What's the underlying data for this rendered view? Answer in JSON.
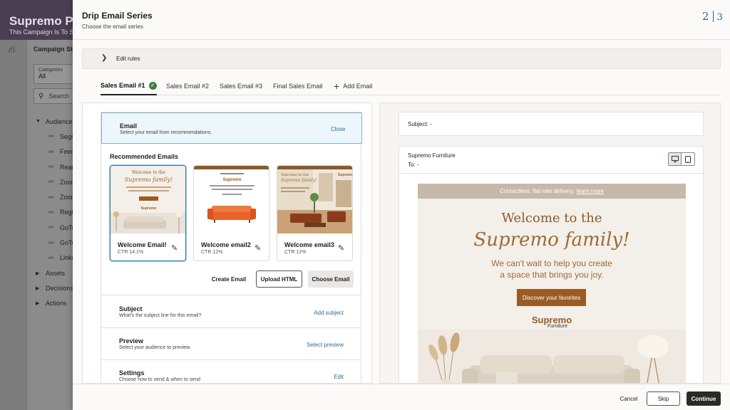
{
  "background": {
    "app_title": "Supremo Pro",
    "app_subtitle": "This Campaign Is To Send",
    "steps_label": "Campaign Ste",
    "categories_label": "Categories",
    "categories_value": "All",
    "search_placeholder": "Search",
    "tree": [
      {
        "label": "Audience",
        "kind": "group-open"
      },
      {
        "label": "Segm",
        "kind": "child"
      },
      {
        "label": "Feed",
        "kind": "child"
      },
      {
        "label": "Read",
        "kind": "child"
      },
      {
        "label": "Zoon",
        "kind": "child"
      },
      {
        "label": "Zoon",
        "kind": "child"
      },
      {
        "label": "Regis",
        "kind": "child"
      },
      {
        "label": "GoTo",
        "kind": "child"
      },
      {
        "label": "GoTo",
        "kind": "child"
      },
      {
        "label": "Linke",
        "kind": "child"
      },
      {
        "label": "Assets",
        "kind": "group"
      },
      {
        "label": "Decisions",
        "kind": "group"
      },
      {
        "label": "Actions",
        "kind": "group"
      }
    ]
  },
  "drawer": {
    "title": "Drip Email Series",
    "subtitle": "Choose the email series",
    "step_current": "2",
    "step_total": "3",
    "edit_rules": "Edit rules"
  },
  "tabs": [
    {
      "label": "Sales Email #1",
      "active": true
    },
    {
      "label": "Sales Email #2",
      "active": false
    },
    {
      "label": "Sales Email #3",
      "active": false
    },
    {
      "label": "Final Sales Email",
      "active": false
    }
  ],
  "add_email_label": "Add Email",
  "email_section": {
    "title": "Email",
    "subtitle": "Select your email from recommendations.",
    "close_label": "Close",
    "recommended_title": "Recommended Emails",
    "recommendations": [
      {
        "name": "Welcome Email!",
        "ctr": "CTR 14.1%"
      },
      {
        "name": "Welcome email2",
        "ctr": "CTR 12%"
      },
      {
        "name": "Welcome email3",
        "ctr": "CTR 12%"
      }
    ],
    "create_label": "Create Email",
    "upload_label": "Upload HTML",
    "choose_label": "Choose Email"
  },
  "sections": {
    "subject": {
      "title": "Subject",
      "subtitle": "What's the subject line for this email?",
      "action": "Add subject"
    },
    "preview": {
      "title": "Preview",
      "subtitle": "Select your audience to preview.",
      "action": "Select preview"
    },
    "settings": {
      "title": "Settings",
      "subtitle": "Choose how to send & when to send",
      "action": "Edit"
    }
  },
  "preview_panel": {
    "subject_line": "Subject: -",
    "from_name": "Supremo Furniture",
    "to_line": "To:  -",
    "email": {
      "top_bar_text": "Contactless, flat-rate delivery,",
      "top_bar_link": "learn more",
      "welcome": "Welcome to the",
      "family": "Supremo family!",
      "body_line1": "We can't wait to help you create",
      "body_line2": "a space that brings you joy.",
      "cta": "Discover your favorites",
      "logo_top": "Supremo",
      "logo_bottom": "Furniture"
    }
  },
  "footer": {
    "cancel_label": "Cancel",
    "skip_label": "Skip",
    "continue_label": "Continue"
  },
  "colors": {
    "accent_blue": "#2b6f95",
    "success_green": "#3f7d3a",
    "brand_brown": "#9a5b24",
    "primary_button": "#2b2a28"
  }
}
